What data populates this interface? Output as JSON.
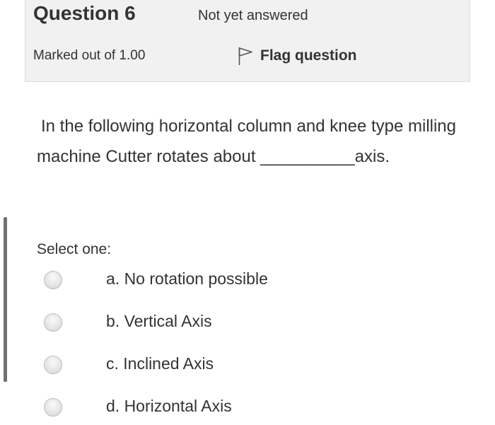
{
  "question": {
    "title": "Question 6",
    "state": "Not yet answered",
    "grade": "Marked out of 1.00",
    "flag_label": "Flag question",
    "flag_icon": "flag-icon",
    "text": "In the following horizontal column and knee type milling machine Cutter rotates about __________axis."
  },
  "answer": {
    "prompt": "Select one:",
    "options": [
      {
        "label": "a. No rotation possible",
        "selected": false
      },
      {
        "label": "b. Vertical Axis",
        "selected": false
      },
      {
        "label": "c. Inclined Axis",
        "selected": false
      },
      {
        "label": "d. Horizontal Axis",
        "selected": false
      }
    ]
  },
  "colors": {
    "info_background": "#f1f1f1",
    "text": "#333333",
    "answer_bar": "#707070"
  }
}
